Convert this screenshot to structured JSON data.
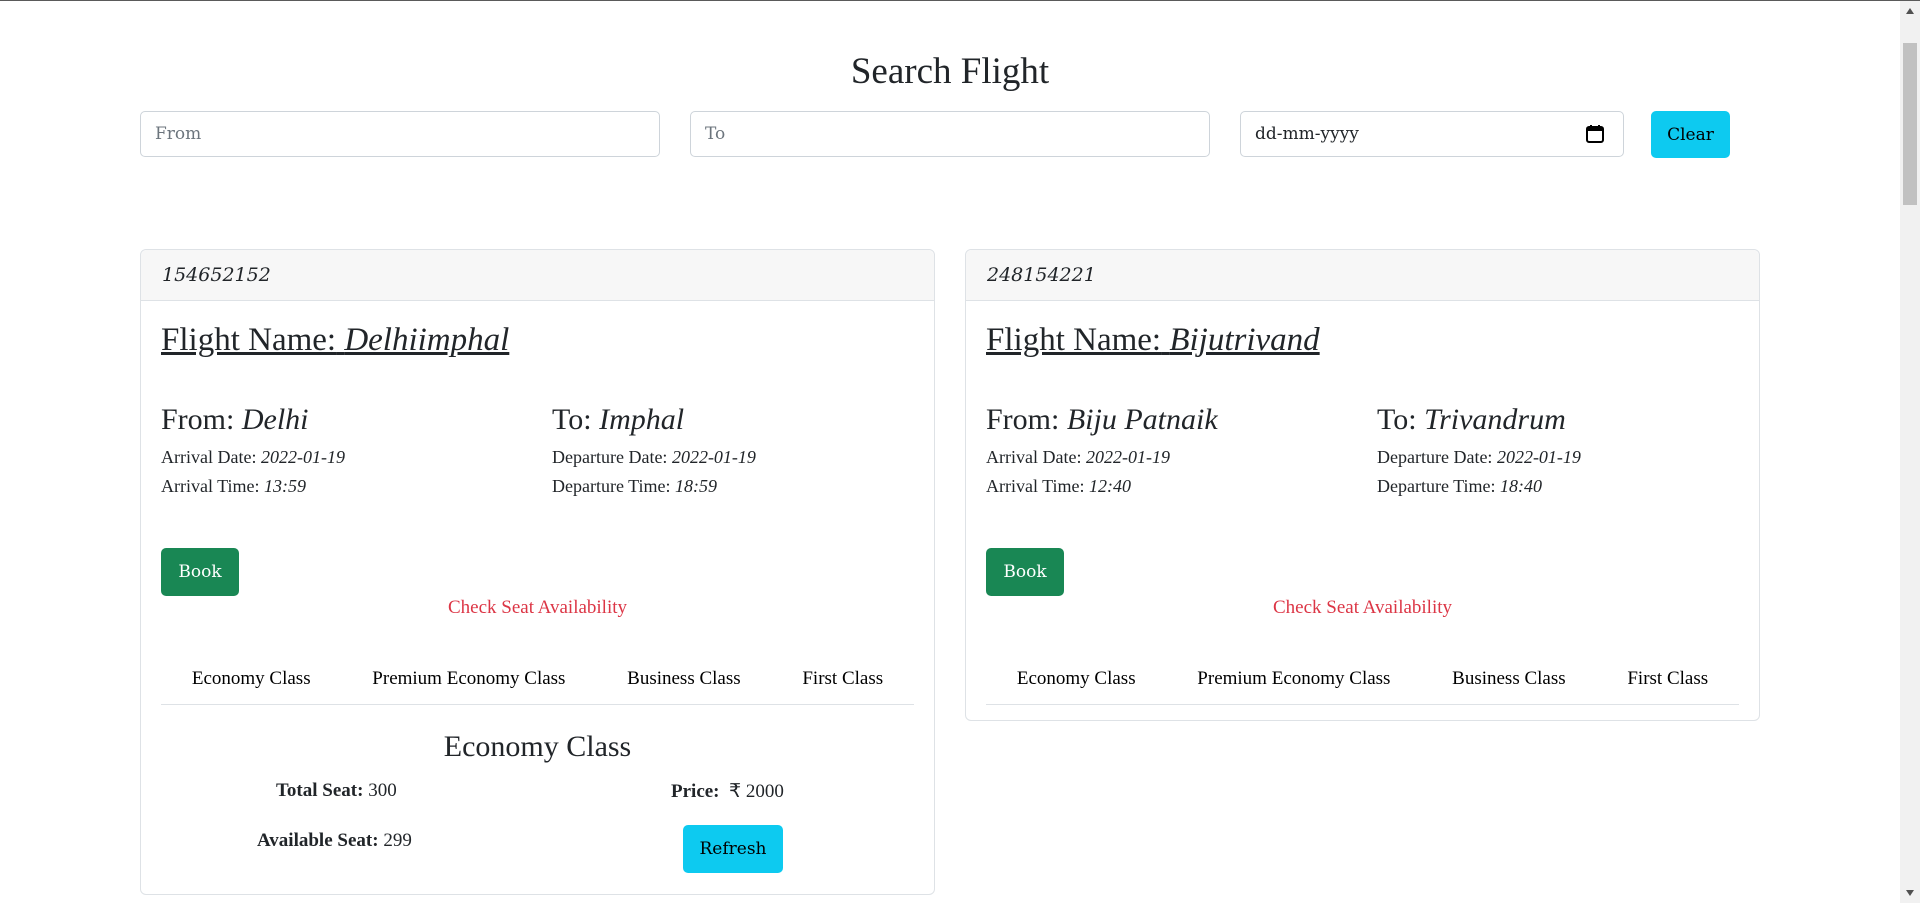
{
  "page": {
    "title": "Search Flight"
  },
  "search": {
    "from_placeholder": "From",
    "to_placeholder": "To",
    "date_value": "dd-mm-yyyy",
    "clear_label": "Clear"
  },
  "labels": {
    "flight_name": "Flight Name:",
    "from": "From:",
    "to": "To:",
    "arrival_date": "Arrival Date:",
    "departure_date": "Departure Date:",
    "arrival_time": "Arrival Time:",
    "departure_time": "Departure Time:",
    "book": "Book",
    "check_seat": "Check Seat Availability",
    "total_seat": "Total Seat:",
    "available_seat": "Available Seat:",
    "price": "Price:",
    "refresh": "Refresh"
  },
  "tabs": [
    "Economy Class",
    "Premium Economy Class",
    "Business Class",
    "First Class"
  ],
  "flights": [
    {
      "id": "154652152",
      "name": "Delhiimphal",
      "from": "Delhi",
      "to": "Imphal",
      "arrival_date": "2022-01-19",
      "departure_date": "2022-01-19",
      "arrival_time": "13:59",
      "departure_time": "18:59",
      "seat_info": {
        "class_name": "Economy Class",
        "total_seat": "300",
        "available_seat": "299",
        "price": "₹ 2000"
      }
    },
    {
      "id": "248154221",
      "name": "Bijutrivand",
      "from": "Biju Patnaik",
      "to": "Trivandrum",
      "arrival_date": "2022-01-19",
      "departure_date": "2022-01-19",
      "arrival_time": "12:40",
      "departure_time": "18:40"
    }
  ],
  "colors": {
    "success": "#198754",
    "info": "#0dcaf0",
    "danger": "#dc3545",
    "border": "#dee2e6"
  }
}
